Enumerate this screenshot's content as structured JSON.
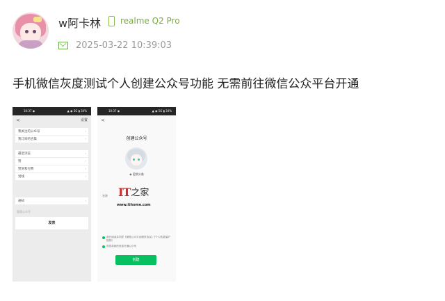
{
  "post": {
    "username": "w阿卡林",
    "device": "realme Q2 Pro",
    "timestamp": "2025-03-22 10:39:03",
    "title": "手机微信灰度测试个人创建公众号功能 无需前往微信公众平台开通"
  },
  "screenshot_left": {
    "status_time": "10:37 ◉",
    "status_sys": "▲ ◉ 5G ▮ 34%",
    "back": "<",
    "action": "设置",
    "group1": [
      "我关注的公众号",
      "我订阅的合集"
    ],
    "group2": [
      "最近浏览",
      "赞",
      "赞赏和付费",
      "划线"
    ],
    "group3": [
      "通知"
    ],
    "hint": "管理公众号",
    "publish_label": "发表"
  },
  "screenshot_right": {
    "status_time": "10:37 ◉",
    "status_sys": "▲ ◉ 5G ▮ 34%",
    "back": "<",
    "title": "创建公众号",
    "edit_avatar": "◉ 更换头像",
    "name_label": "名称",
    "watermark_it": "IT",
    "watermark_zh": "之家",
    "watermark_url": "www.ithome.com",
    "agree_1": "我已阅读并同意《微信公众平台服务协议》《个人信息保护规则》",
    "agree_2": "同意将我的信息开通公众号",
    "create_button": "创建"
  },
  "icons": {
    "device": "phone-icon",
    "timestamp": "mail-icon"
  },
  "colors": {
    "device_green": "#7aae3c",
    "wechat_green": "#07c160",
    "ithome_red": "#d12a2a"
  }
}
